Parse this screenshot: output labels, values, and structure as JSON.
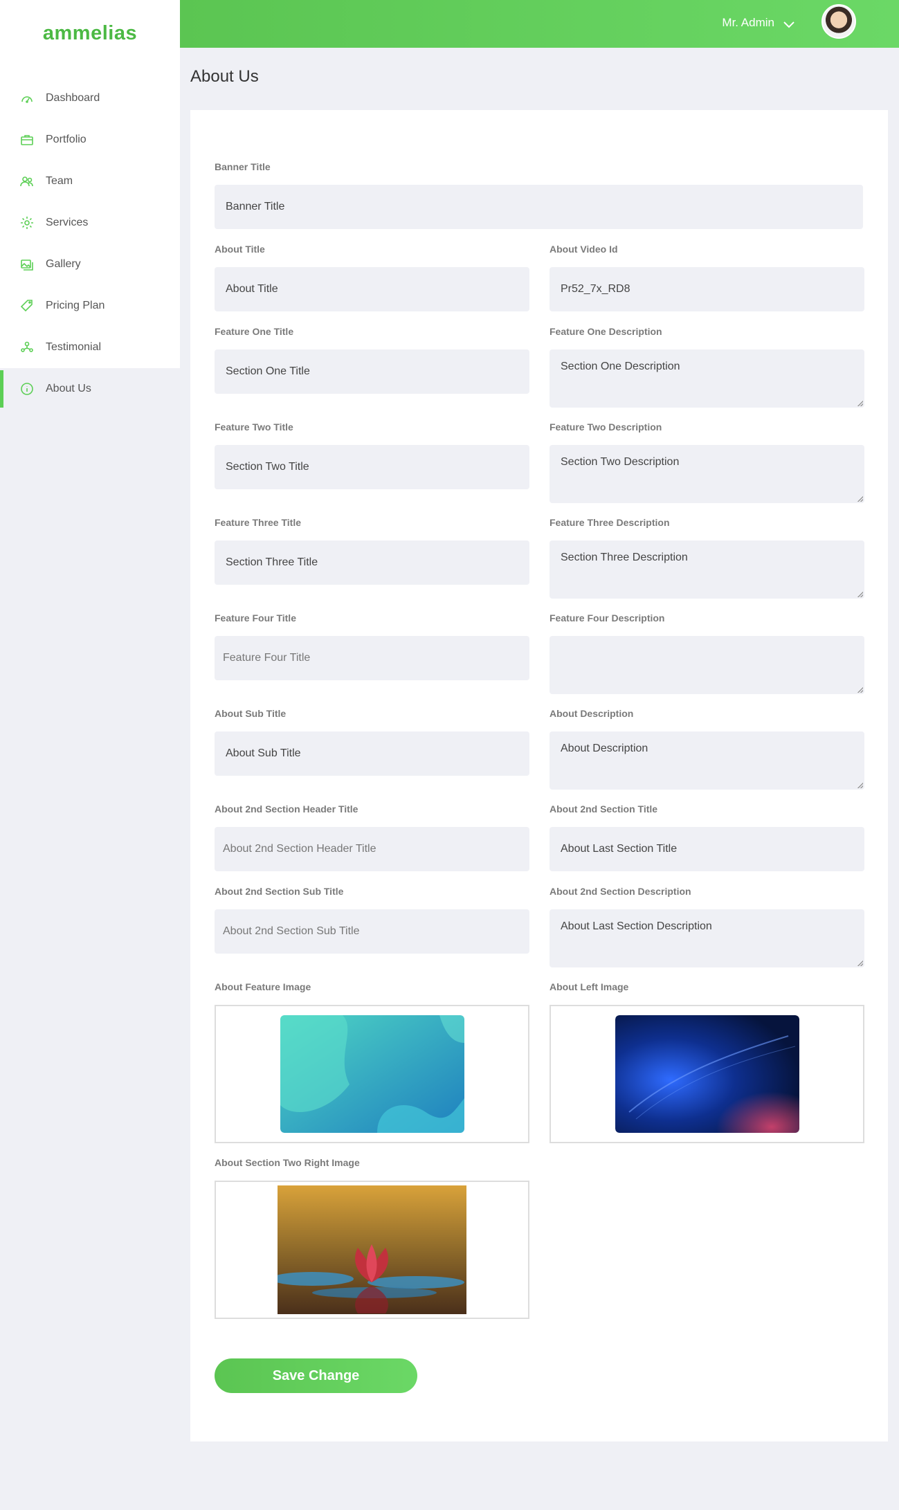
{
  "brand": "ammelias",
  "sidebar": {
    "items": [
      {
        "label": "Dashboard",
        "icon": "dashboard-icon"
      },
      {
        "label": "Portfolio",
        "icon": "briefcase-icon"
      },
      {
        "label": "Team",
        "icon": "team-icon"
      },
      {
        "label": "Services",
        "icon": "gear-icon"
      },
      {
        "label": "Gallery",
        "icon": "gallery-icon"
      },
      {
        "label": "Pricing Plan",
        "icon": "tag-icon"
      },
      {
        "label": "Testimonial",
        "icon": "testimonial-icon"
      },
      {
        "label": "About Us",
        "icon": "info-icon",
        "active": true
      }
    ]
  },
  "header": {
    "user": "Mr. Admin"
  },
  "page": {
    "title": "About Us"
  },
  "form": {
    "banner_title": {
      "label": "Banner Title",
      "value": "Banner Title"
    },
    "about_title": {
      "label": "About Title",
      "value": "About Title"
    },
    "about_video_id": {
      "label": "About Video Id",
      "value": "Pr52_7x_RD8"
    },
    "feature_one_title": {
      "label": "Feature One Title",
      "value": "Section One Title"
    },
    "feature_one_desc": {
      "label": "Feature One Description",
      "value": "Section One Description"
    },
    "feature_two_title": {
      "label": "Feature Two Title",
      "value": "Section Two Title"
    },
    "feature_two_desc": {
      "label": "Feature Two Description",
      "value": "Section Two Description"
    },
    "feature_three_title": {
      "label": "Feature Three Title",
      "value": "Section Three Title"
    },
    "feature_three_desc": {
      "label": "Feature Three Description",
      "value": "Section Three Description"
    },
    "feature_four_title": {
      "label": "Feature Four Title",
      "placeholder": "Feature Four Title"
    },
    "feature_four_desc": {
      "label": "Feature Four Description",
      "value": ""
    },
    "about_sub_title": {
      "label": "About Sub Title",
      "value": "About Sub Title"
    },
    "about_description": {
      "label": "About Description",
      "value": "About Description"
    },
    "second_header_title": {
      "label": "About 2nd Section Header Title",
      "placeholder": "About 2nd Section Header Title"
    },
    "second_title": {
      "label": "About 2nd Section Title",
      "value": "About Last Section Title"
    },
    "second_sub_title": {
      "label": "About 2nd Section Sub Title",
      "placeholder": "About 2nd Section Sub Title"
    },
    "second_description": {
      "label": "About 2nd Section Description",
      "value": "About Last Section Description"
    },
    "feature_image": {
      "label": "About Feature Image"
    },
    "left_image": {
      "label": "About Left Image"
    },
    "section_two_right_image": {
      "label": "About Section Two Right Image"
    },
    "save_label": "Save Change"
  }
}
